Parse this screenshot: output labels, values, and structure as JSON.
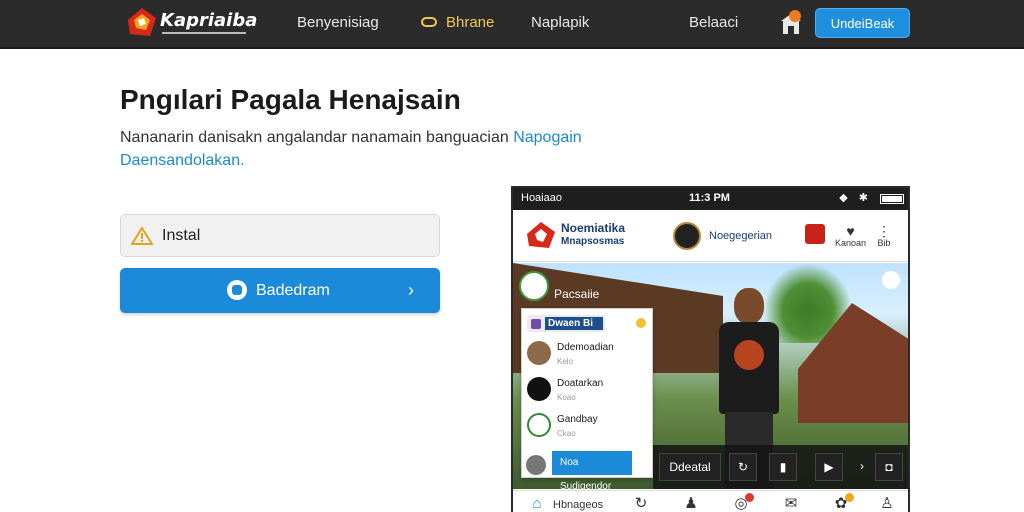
{
  "nav": {
    "brand": "Kapriaiba",
    "links": [
      "Benyenisiag",
      "Bhrane",
      "Naplapik",
      "Belaaci"
    ],
    "cta": "UndeiBeak",
    "accent": "#f2c84b",
    "cta_color": "#1f8fe0"
  },
  "hero": {
    "title": "Pngılari Pagala Henajsain",
    "desc_main": "Nananarin danisakn angalandar nanamain banguacian ",
    "desc_link": "Napogain",
    "desc_line2": "Daensandolakan."
  },
  "install": {
    "label": "Instal",
    "icon": "warning-icon"
  },
  "download": {
    "label": "Badedram",
    "icon": "download-icon"
  },
  "phone": {
    "status_left": "Hoaiaao",
    "status_time": "11:3 PM",
    "app_title": "Noemiatika",
    "app_subtitle": "Mnapsosmas",
    "app_user": "Noegegerian",
    "actions": [
      {
        "label": "Kanoan",
        "icon": "profile-icon"
      },
      {
        "label": "Bib",
        "icon": "menu-icon"
      }
    ],
    "story_label": "Pacsaiie",
    "chat_header": "Dwaen Bi",
    "chats": [
      {
        "name": "Ddemoadian",
        "sub": "Kelo",
        "color": "#8c6a4a"
      },
      {
        "name": "Doatarkan",
        "sub": "Koao",
        "color": "#111111"
      },
      {
        "name": "Gandbay",
        "sub": "Ckao",
        "color": "#ffffff"
      }
    ],
    "chat_cta": "Noa Sudjgendor",
    "overlay_btn": "Ddeatal",
    "tab_label": "Hbnageos"
  }
}
